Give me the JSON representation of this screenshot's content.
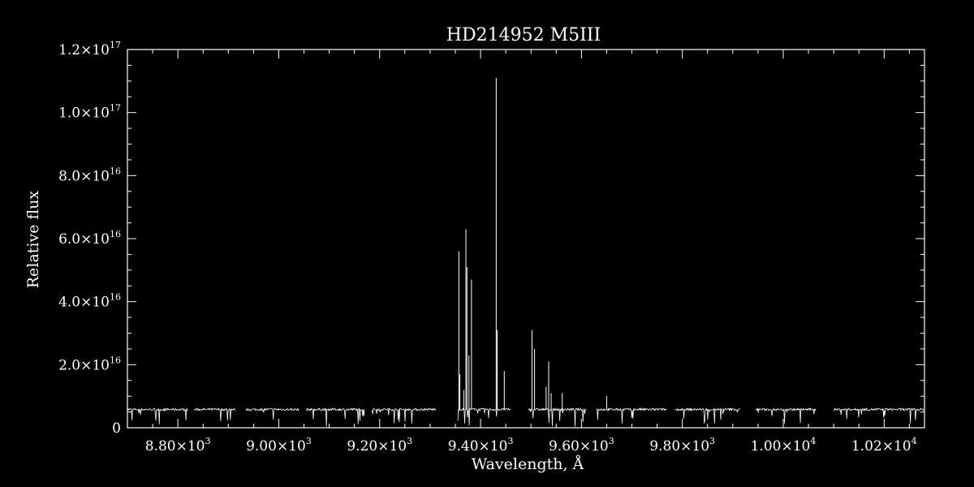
{
  "chart_data": {
    "type": "line",
    "title": "HD214952   M5III",
    "xlabel": "Wavelength, Å",
    "ylabel": "Relative flux",
    "xlim": [
      8700,
      10280
    ],
    "ylim": [
      0,
      1.2e+17
    ],
    "x_ticks": [
      {
        "value": 8800,
        "mantissa": "8.80",
        "exp": "3"
      },
      {
        "value": 9000,
        "mantissa": "9.00",
        "exp": "3"
      },
      {
        "value": 9200,
        "mantissa": "9.20",
        "exp": "3"
      },
      {
        "value": 9400,
        "mantissa": "9.40",
        "exp": "3"
      },
      {
        "value": 9600,
        "mantissa": "9.60",
        "exp": "3"
      },
      {
        "value": 9800,
        "mantissa": "9.80",
        "exp": "3"
      },
      {
        "value": 10000,
        "mantissa": "1.00",
        "exp": "4"
      },
      {
        "value": 10200,
        "mantissa": "1.02",
        "exp": "4"
      }
    ],
    "y_ticks": [
      {
        "value": 0,
        "mantissa": "0",
        "exp": ""
      },
      {
        "value": 2e+16,
        "mantissa": "2.0",
        "exp": "16"
      },
      {
        "value": 4e+16,
        "mantissa": "4.0",
        "exp": "16"
      },
      {
        "value": 6e+16,
        "mantissa": "6.0",
        "exp": "16"
      },
      {
        "value": 8e+16,
        "mantissa": "8.0",
        "exp": "16"
      },
      {
        "value": 1e+17,
        "mantissa": "1.0",
        "exp": "17"
      },
      {
        "value": 1.2e+17,
        "mantissa": "1.2",
        "exp": "17"
      }
    ],
    "continuum_level": 5800000000000000.0,
    "segments": [
      [
        8700,
        8820
      ],
      [
        8832,
        8915
      ],
      [
        8935,
        9040
      ],
      [
        9055,
        9170
      ],
      [
        9185,
        9312
      ],
      [
        9355,
        9460
      ],
      [
        9495,
        9610
      ],
      [
        9630,
        9770
      ],
      [
        9785,
        9915
      ],
      [
        9945,
        10065
      ],
      [
        10100,
        10280
      ]
    ],
    "spikes": [
      {
        "x": 9357,
        "y": 5.6e+16
      },
      {
        "x": 9359,
        "y": 1.7e+16
      },
      {
        "x": 9367,
        "y": 1.2e+16
      },
      {
        "x": 9371,
        "y": 6.3e+16
      },
      {
        "x": 9373,
        "y": 5.1e+16
      },
      {
        "x": 9377,
        "y": 2.3e+16
      },
      {
        "x": 9382,
        "y": 4.7e+16
      },
      {
        "x": 9431,
        "y": 1.11e+17
      },
      {
        "x": 9433,
        "y": 3.1e+16
      },
      {
        "x": 9447,
        "y": 1.8e+16
      },
      {
        "x": 9502,
        "y": 3.1e+16
      },
      {
        "x": 9507,
        "y": 2.5e+16
      },
      {
        "x": 9530,
        "y": 1.3e+16
      },
      {
        "x": 9535,
        "y": 2.1e+16
      },
      {
        "x": 9540,
        "y": 1.1e+16
      },
      {
        "x": 9562,
        "y": 1.1e+16
      },
      {
        "x": 9650,
        "y": 1e+16
      }
    ],
    "grid": false,
    "colors": {
      "background": "#000000",
      "foreground": "#ffffff"
    }
  }
}
